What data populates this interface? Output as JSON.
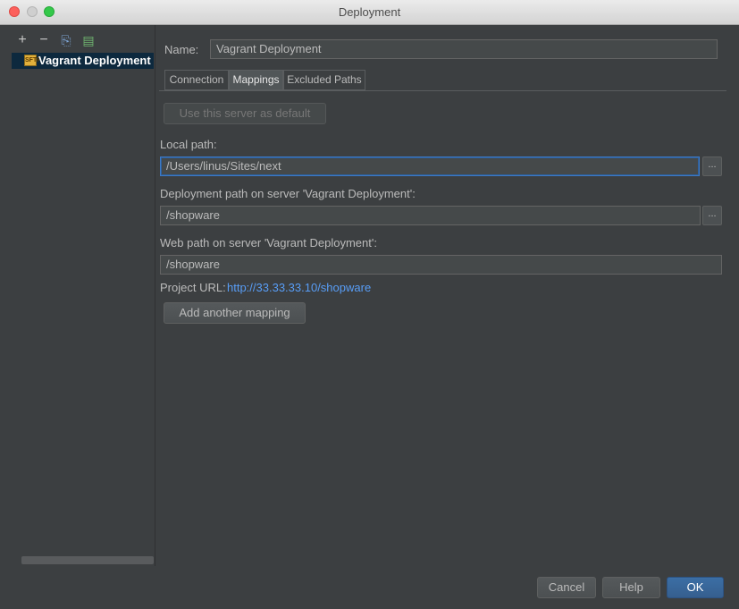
{
  "window": {
    "title": "Deployment"
  },
  "toolbar": {
    "add": "+",
    "remove": "−",
    "copy": "⎘",
    "export": "▤"
  },
  "tree": {
    "items": [
      {
        "label": "Vagrant Deployment",
        "icon": "server-icon"
      }
    ]
  },
  "form": {
    "name_label": "Name:",
    "name_value": "Vagrant Deployment",
    "tabs": [
      {
        "label": "Connection"
      },
      {
        "label": "Mappings"
      },
      {
        "label": "Excluded Paths"
      }
    ],
    "active_tab": "Mappings",
    "default_button": "Use this server as default",
    "local_path_label": "Local path:",
    "local_path_value": "/Users/linus/Sites/next",
    "deploy_path_label": "Deployment path on server 'Vagrant Deployment':",
    "deploy_path_value": "/shopware",
    "web_path_label": "Web path on server 'Vagrant Deployment':",
    "web_path_value": "/shopware",
    "project_url_label": "Project URL:",
    "project_url_value": "http://33.33.33.10/shopware",
    "browse_label": "...",
    "add_mapping_button": "Add another mapping"
  },
  "footer": {
    "cancel": "Cancel",
    "help": "Help",
    "ok": "OK"
  },
  "colors": {
    "background": "#3c3f41",
    "selection": "#0d293e",
    "link": "#589df6",
    "primary": "#365f8f",
    "focus": "#3d7ac6"
  }
}
